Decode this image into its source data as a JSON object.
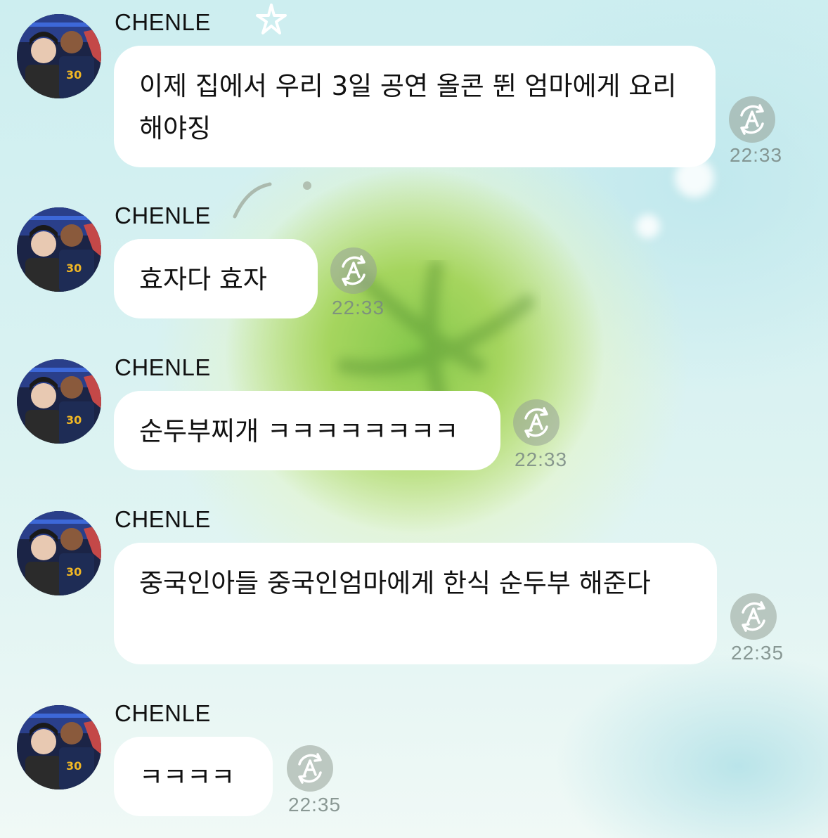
{
  "messages": [
    {
      "sender": "CHENLE",
      "text": "이제 집에서 우리 3일 공연 올콘 뛴 엄마에게 요리 해야징",
      "time": "22:33"
    },
    {
      "sender": "CHENLE",
      "text": "효자다 효자",
      "time": "22:33"
    },
    {
      "sender": "CHENLE",
      "text": "순두부찌개 ㅋㅋㅋㅋㅋㅋㅋㅋ",
      "time": "22:33"
    },
    {
      "sender": "CHENLE",
      "text": "중국인아들 중국인엄마에게 한식 순두부 해준다",
      "time": "22:35"
    },
    {
      "sender": "CHENLE",
      "text": "ㅋㅋㅋㅋ",
      "time": "22:35"
    }
  ],
  "icons": {
    "translate": "translate-a-icon",
    "avatar": "profile-photo"
  },
  "colors": {
    "bubble": "#ffffff",
    "time": "#8a9691",
    "translate_button": "#9ea69e",
    "background_light": "#d4f0f1",
    "background_green": "#8ccb52"
  }
}
